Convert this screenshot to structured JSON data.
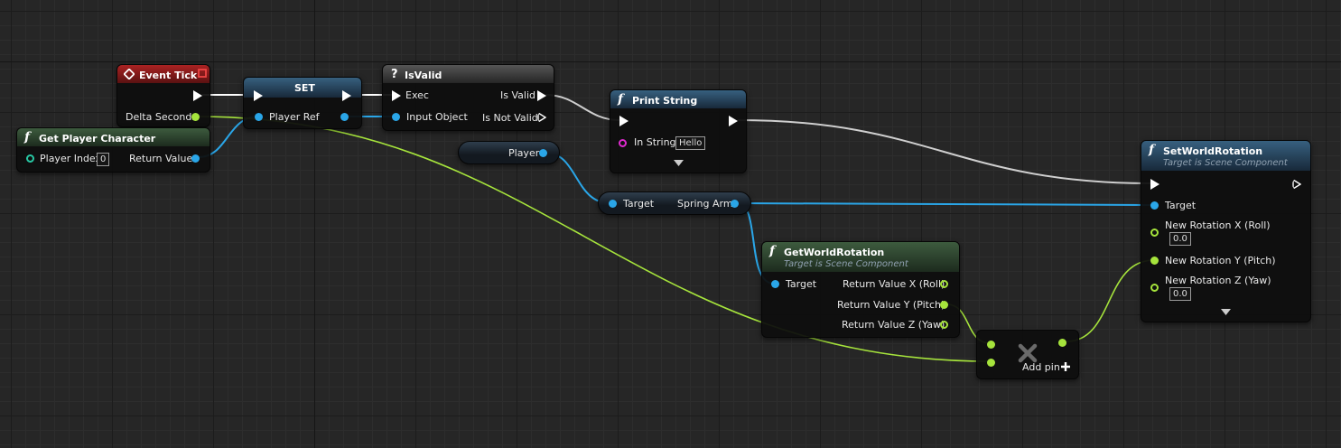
{
  "colors": {
    "exec": "#ffffff",
    "object": "#2aa6e8",
    "float": "#a6e43c",
    "int": "#28c8a4",
    "string": "#e02ad0",
    "event_header": "#a22222",
    "pure_header": "#3d5b3e",
    "function_header": "#37607f",
    "macro_header": "#555555"
  },
  "nodes": {
    "event_tick": {
      "title": "Event Tick",
      "delta_seconds": "Delta Seconds"
    },
    "get_player_character": {
      "title": "Get Player Character",
      "player_index": "Player Index",
      "player_index_value": "0",
      "return_value": "Return Value"
    },
    "set_node": {
      "title": "SET",
      "player_ref": "Player Ref"
    },
    "is_valid": {
      "title": "IsValid",
      "exec": "Exec",
      "input_object": "Input Object",
      "is_valid": "Is Valid",
      "is_not_valid": "Is Not Valid"
    },
    "player_getter": {
      "label": "Player"
    },
    "print_string": {
      "title": "Print String",
      "in_string": "In String",
      "in_string_value": "Hello"
    },
    "spring_arm_getter": {
      "target": "Target",
      "spring_arm": "Spring Arm"
    },
    "get_world_rotation": {
      "title": "GetWorldRotation",
      "subtitle": "Target is Scene Component",
      "target": "Target",
      "return_x": "Return Value X (Roll)",
      "return_y": "Return Value Y (Pitch)",
      "return_z": "Return Value Z (Yaw)"
    },
    "add_node": {
      "add_pin": "Add pin"
    },
    "set_world_rotation": {
      "title": "SetWorldRotation",
      "subtitle": "Target is Scene Component",
      "target": "Target",
      "rot_x": "New Rotation X (Roll)",
      "rot_x_value": "0.0",
      "rot_y": "New Rotation Y (Pitch)",
      "rot_z": "New Rotation Z (Yaw)",
      "rot_z_value": "0.0"
    }
  }
}
